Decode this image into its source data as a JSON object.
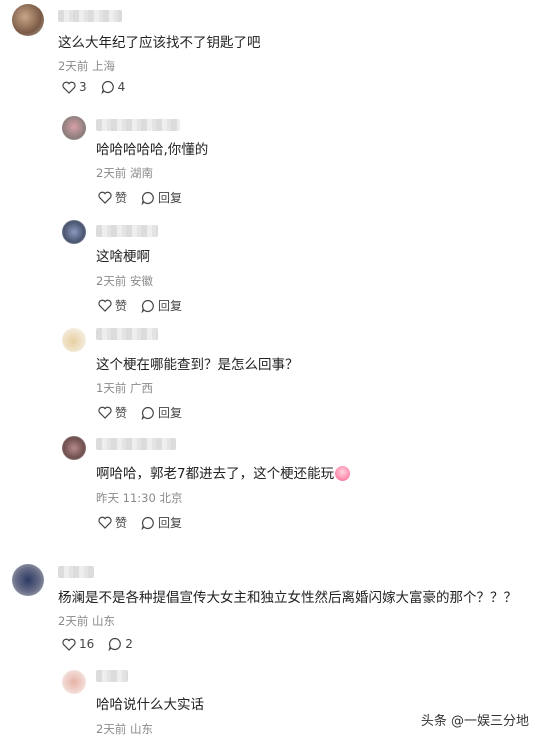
{
  "comments": [
    {
      "avatar": "user-avatar",
      "text": "这么大年纪了应该找不了钥匙了吧",
      "meta": "2天前 上海",
      "likes": "3",
      "replies": "4"
    },
    {
      "avatar": "user-avatar",
      "text": "哈哈哈哈哈,你懂的",
      "meta": "2天前 湖南",
      "like_label": "赞",
      "reply_label": "回复"
    },
    {
      "avatar": "user-avatar",
      "text": "这啥梗啊",
      "meta": "2天前 安徽",
      "like_label": "赞",
      "reply_label": "回复"
    },
    {
      "avatar": "user-avatar",
      "text": "这个梗在哪能查到？是怎么回事？",
      "meta": "1天前 广西",
      "like_label": "赞",
      "reply_label": "回复"
    },
    {
      "avatar": "user-avatar",
      "text": "啊哈哈，郭老7都进去了，这个梗还能玩",
      "meta": "昨天 11:30 北京",
      "like_label": "赞",
      "reply_label": "回复"
    },
    {
      "avatar": "user-avatar",
      "text": "杨澜是不是各种提倡宣传大女主和独立女性然后离婚闪嫁大富豪的那个？？？",
      "meta": "2天前 山东",
      "likes": "16",
      "replies": "2"
    },
    {
      "avatar": "user-avatar",
      "text": "哈哈说什么大实话",
      "meta": "2天前 山东"
    }
  ],
  "watermark": "头条 @一娱三分地",
  "icons": {
    "like": "heart-icon",
    "reply": "comment-bubble-icon",
    "emoji": "clown-face-emoji"
  }
}
